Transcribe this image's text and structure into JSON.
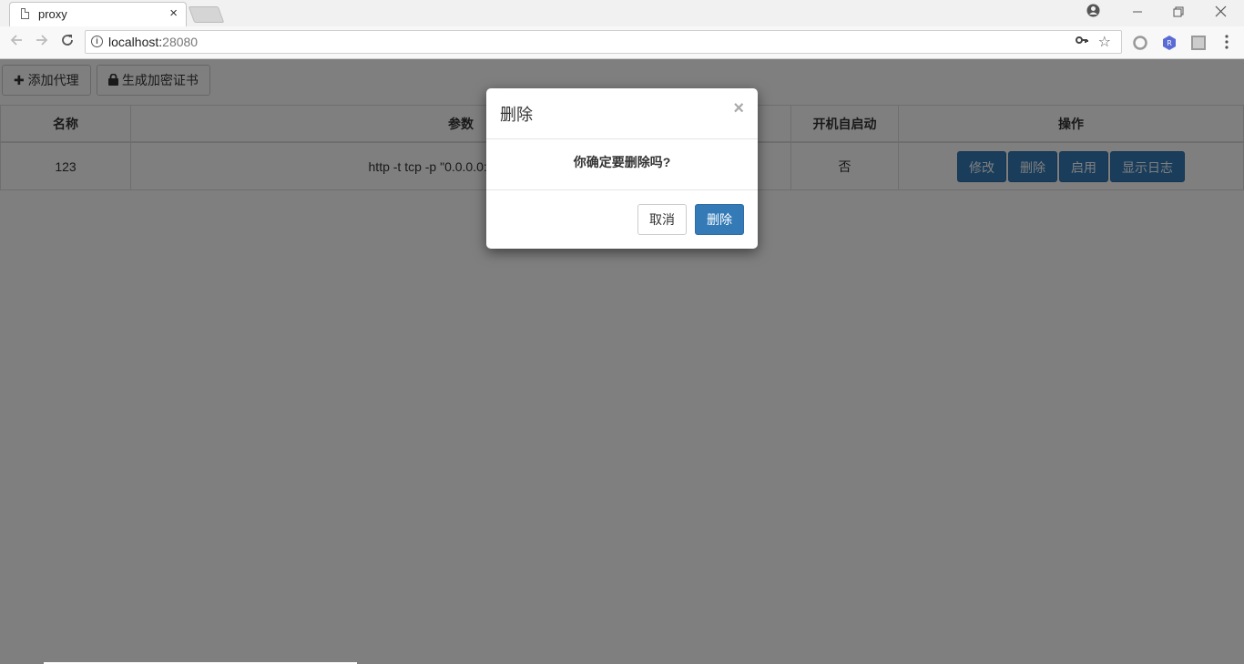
{
  "browser": {
    "tab_title": "proxy",
    "tab_close": "×",
    "url_host": "localhost:",
    "url_port": "28080"
  },
  "toolbar": {
    "add_proxy_label": "添加代理",
    "gen_cert_label": "生成加密证书"
  },
  "table": {
    "headers": [
      "名称",
      "参数",
      "开机自启动",
      "操作"
    ],
    "rows": [
      {
        "name": "123",
        "params": "http -t tcp -p \"0.0.0.0:38080\" --da",
        "autostart": "否",
        "actions": [
          "修改",
          "删除",
          "启用",
          "显示日志"
        ]
      }
    ]
  },
  "modal": {
    "title": "删除",
    "close": "×",
    "message": "你确定要删除吗?",
    "cancel_label": "取消",
    "confirm_label": "删除"
  },
  "colors": {
    "primary": "#337ab7",
    "overlay": "rgba(0,0,0,0.5)"
  }
}
